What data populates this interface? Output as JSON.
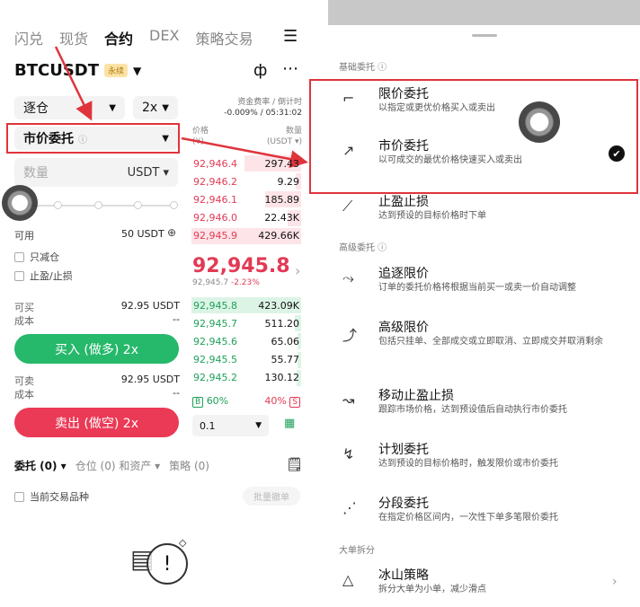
{
  "left": {
    "tabs": [
      "闪兑",
      "现货",
      "合约",
      "DEX",
      "策略交易"
    ],
    "symbol": "BTCUSDT",
    "perp_badge": "永续",
    "margin_mode": "逐仓",
    "leverage": "2x",
    "order_type": "市价委托",
    "qty_placeholder": "数量",
    "qty_unit": "USDT",
    "available_label": "可用",
    "available_value": "50 USDT",
    "reduce_only": "只减仓",
    "tp_sl": "止盈/止损",
    "can_buy_label": "可买",
    "can_buy_value": "92.95 USDT",
    "cost_label": "成本",
    "cost_value": "--",
    "buy_button": "买入 (做多) 2x",
    "can_sell_label": "可卖",
    "can_sell_value": "92.95 USDT",
    "cost2_label": "成本",
    "cost2_value": "--",
    "sell_button": "卖出 (做空) 2x",
    "funding_label": "资金费率 / 倒计时",
    "funding_value": "-0.009% / 05:31:02",
    "price_col": "价格",
    "price_unit": "(¥)",
    "qty_col": "数量",
    "qty_col_unit": "(USDT ▾)",
    "asks": [
      {
        "price": "92,946.4",
        "qty": "297.43",
        "depth": 0.52
      },
      {
        "price": "92,946.2",
        "qty": "9.29",
        "depth": 0.05
      },
      {
        "price": "92,946.1",
        "qty": "185.89",
        "depth": 0.33
      },
      {
        "price": "92,946.0",
        "qty": "22.43K",
        "depth": 0.12
      },
      {
        "price": "92,945.9",
        "qty": "429.66K",
        "depth": 1.0
      }
    ],
    "mid_price": "92,945.8",
    "mid_sub": "92,945.7",
    "mid_change": "-2.23%",
    "bids": [
      {
        "price": "92,945.8",
        "qty": "423.09K",
        "depth": 1.0
      },
      {
        "price": "92,945.7",
        "qty": "511.20",
        "depth": 0.06
      },
      {
        "price": "92,945.6",
        "qty": "65.06",
        "depth": 0.03
      },
      {
        "price": "92,945.5",
        "qty": "55.77",
        "depth": 0.03
      },
      {
        "price": "92,945.2",
        "qty": "130.12",
        "depth": 0.04
      }
    ],
    "buy_ratio_tag": "B",
    "buy_ratio": "60%",
    "sell_ratio": "40%",
    "sell_ratio_tag": "S",
    "precision": "0.1",
    "bottom_tabs": [
      "委托 (0) ▾",
      "仓位 (0) 和资产 ▾",
      "策略 (0)"
    ],
    "current_pair": "当前交易品种",
    "batch_cancel": "批量撤单"
  },
  "right": {
    "basic_section": "基础委托 ⓘ",
    "advanced_section": "高级委托 ⓘ",
    "big_section": "大单拆分",
    "items": [
      {
        "title": "限价委托",
        "desc": "以指定或更优价格买入或卖出",
        "icon": "limit-icon"
      },
      {
        "title": "市价委托",
        "desc": "以可成交的最优价格快速买入或卖出",
        "icon": "market-icon"
      },
      {
        "title": "止盈止损",
        "desc": "达到预设的目标价格时下单",
        "icon": "tpsl-icon"
      },
      {
        "title": "追逐限价",
        "desc": "订单的委托价格将根据当前买一或卖一价自动调整",
        "icon": "chase-icon"
      },
      {
        "title": "高级限价",
        "desc": "包括只挂单、全部成交或立即取消、立即成交并取消剩余",
        "icon": "adv-limit-icon"
      },
      {
        "title": "移动止盈止损",
        "desc": "跟踪市场价格，达到预设值后自动执行市价委托",
        "icon": "trailing-icon"
      },
      {
        "title": "计划委托",
        "desc": "达到预设的目标价格时，触发限价或市价委托",
        "icon": "plan-icon"
      },
      {
        "title": "分段委托",
        "desc": "在指定价格区间内，一次性下单多笔限价委托",
        "icon": "scaled-icon"
      },
      {
        "title": "冰山策略",
        "desc": "拆分大单为小单，减少滑点",
        "icon": "iceberg-icon"
      }
    ]
  },
  "colors": {
    "buy": "#26b86b",
    "sell": "#ea3a56",
    "annotation": "#e0343c"
  }
}
